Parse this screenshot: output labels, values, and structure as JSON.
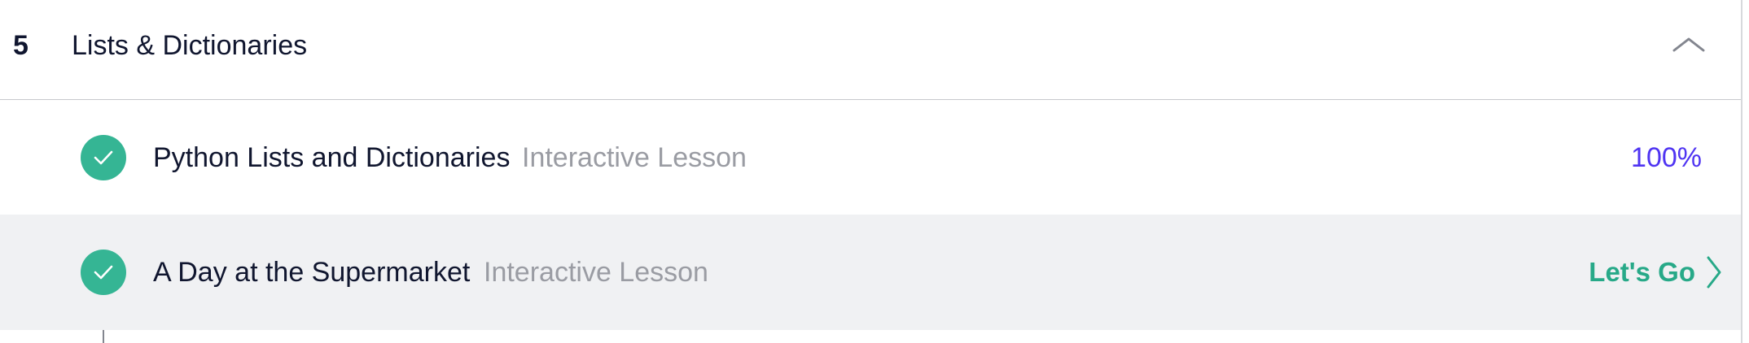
{
  "section": {
    "number": "5",
    "title": "Lists & Dictionaries",
    "toggle_icon": "chevron-up-icon"
  },
  "lessons": [
    {
      "title": "Python Lists and Dictionaries",
      "type": "Interactive Lesson",
      "status_icon": "checkmark-icon",
      "progress": "100%"
    },
    {
      "title": "A Day at the Supermarket",
      "type": "Interactive Lesson",
      "status_icon": "checkmark-icon",
      "action_label": "Let's Go",
      "action_icon": "chevron-right-icon"
    }
  ],
  "colors": {
    "heading_text": "#10162f",
    "secondary_text": "#9a9ca3",
    "success": "#35b594",
    "progress": "#4f34f2",
    "highlight_row": "#f0f1f3"
  }
}
